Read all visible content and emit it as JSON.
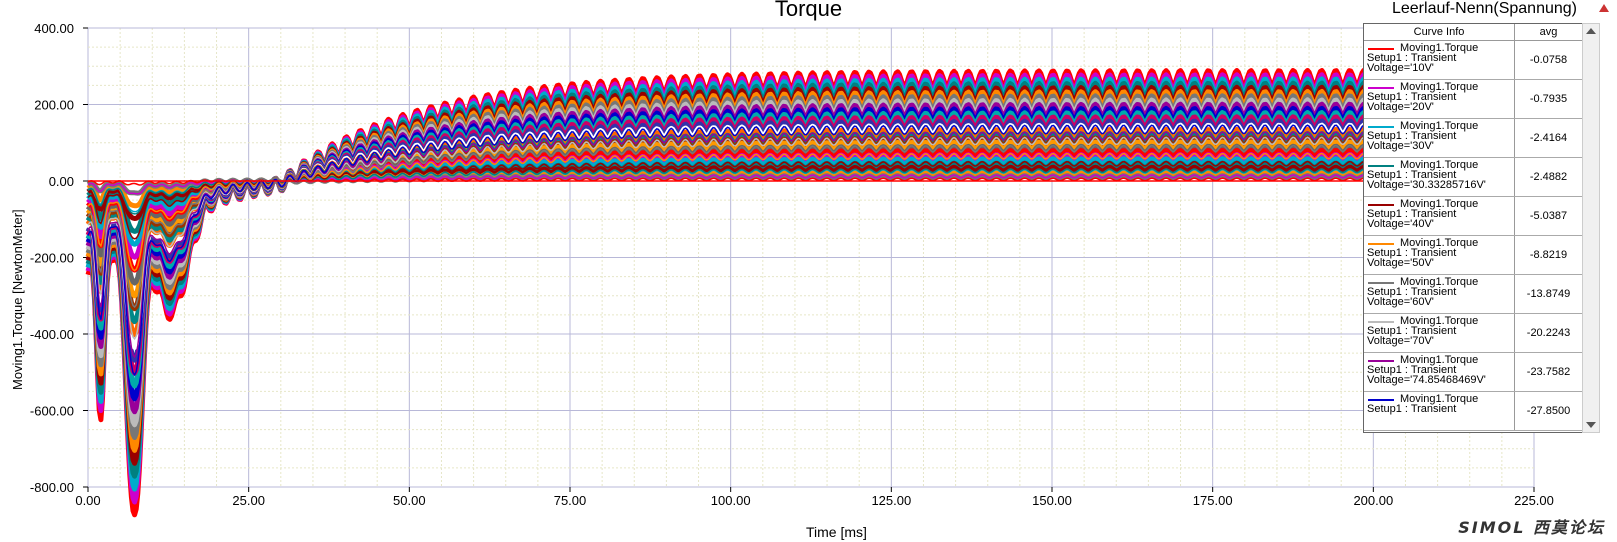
{
  "chart_data": {
    "type": "line",
    "title": "Torque",
    "subtitle": "Leerlauf-Nenn(Spannung)",
    "xlabel": "Time [ms]",
    "ylabel": "Moving1.Torque [NewtonMeter]",
    "xlim": [
      0,
      225
    ],
    "ylim": [
      -800,
      400
    ],
    "xticks": [
      "0.00",
      "25.00",
      "50.00",
      "75.00",
      "100.00",
      "125.00",
      "150.00",
      "175.00",
      "200.00",
      "225.00"
    ],
    "yticks": [
      "400.00",
      "200.00",
      "0.00",
      "-200.00",
      "-400.00",
      "-600.00",
      "-800.00"
    ],
    "grid": true,
    "legend_position": "top-right",
    "legend_header": {
      "info": "Curve Info",
      "avg": "avg"
    },
    "series": [
      {
        "name": "Moving1.Torque",
        "setup": "Setup1 : Transient",
        "param": "Voltage='10V'",
        "avg": "-0.0758",
        "color": "#ff0000",
        "steady": 4,
        "min": -8
      },
      {
        "name": "Moving1.Torque",
        "setup": "Setup1 : Transient",
        "param": "Voltage='20V'",
        "avg": "-0.7935",
        "color": "#cc00cc",
        "steady": 12,
        "min": -30
      },
      {
        "name": "Moving1.Torque",
        "setup": "Setup1 : Transient",
        "param": "Voltage='30V'",
        "avg": "-2.4164",
        "color": "#00aacc",
        "steady": 25,
        "min": -70
      },
      {
        "name": "Moving1.Torque",
        "setup": "Setup1 : Transient",
        "param": "Voltage='30.33285716V'",
        "avg": "-2.4882",
        "color": "#008080",
        "steady": 27,
        "min": -75
      },
      {
        "name": "Moving1.Torque",
        "setup": "Setup1 : Transient",
        "param": "Voltage='40V'",
        "avg": "-5.0387",
        "color": "#990000",
        "steady": 45,
        "min": -130
      },
      {
        "name": "Moving1.Torque",
        "setup": "Setup1 : Transient",
        "param": "Voltage='50V'",
        "avg": "-8.8219",
        "color": "#ff8800",
        "steady": 65,
        "min": -200
      },
      {
        "name": "Moving1.Torque",
        "setup": "Setup1 : Transient",
        "param": "Voltage='60V'",
        "avg": "-13.8749",
        "color": "#777777",
        "steady": 85,
        "min": -280
      },
      {
        "name": "Moving1.Torque",
        "setup": "Setup1 : Transient",
        "param": "Voltage='70V'",
        "avg": "-20.2243",
        "color": "#bbbbbb",
        "steady": 105,
        "min": -350
      },
      {
        "name": "Moving1.Torque",
        "setup": "Setup1 : Transient",
        "param": "Voltage='74.85468469V'",
        "avg": "-23.7582",
        "color": "#990099",
        "steady": 118,
        "min": -390
      },
      {
        "name": "Moving1.Torque",
        "setup": "Setup1 : Transient",
        "param": "",
        "avg": "-27.8500",
        "color": "#0000cc",
        "steady": 135,
        "min": -430
      }
    ],
    "extra_band_colors": [
      "#00aaaa",
      "#cc0066",
      "#3333aa",
      "#ffffff",
      "#ff6600",
      "#008888",
      "#993300",
      "#ff9900",
      "#666666"
    ],
    "envelope_max": 270,
    "envelope_min": -740
  },
  "watermark": "SIMOL 西莫论坛"
}
